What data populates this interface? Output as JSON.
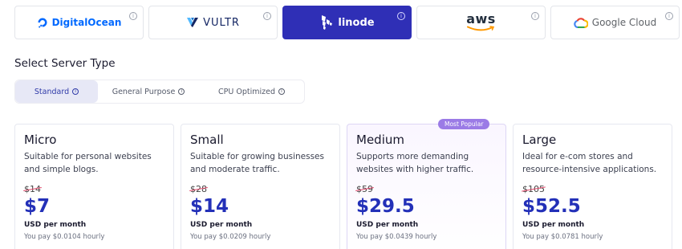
{
  "providers": [
    {
      "name": "DigitalOcean",
      "active": false
    },
    {
      "name": "VULTR",
      "active": false
    },
    {
      "name": "linode",
      "active": true
    },
    {
      "name": "aws",
      "active": false
    },
    {
      "name": "Google Cloud",
      "active": false
    }
  ],
  "section_title": "Select Server Type",
  "tabs": [
    {
      "label": "Standard"
    },
    {
      "label": "General Purpose"
    },
    {
      "label": "CPU Optimized"
    }
  ],
  "cards": [
    {
      "title": "Micro",
      "desc": "Suitable for personal websites and simple blogs.",
      "old_price": "$14",
      "price": "$7",
      "per": "USD per month",
      "hourly": "You pay $0.0104 hourly"
    },
    {
      "title": "Small",
      "desc": "Suitable for growing businesses and moderate traffic.",
      "old_price": "$28",
      "price": "$14",
      "per": "USD per month",
      "hourly": "You pay $0.0209 hourly"
    },
    {
      "title": "Medium",
      "badge": "Most Popular",
      "desc": "Supports more demanding websites with higher traffic.",
      "old_price": "$59",
      "price": "$29.5",
      "per": "USD per month",
      "hourly": "You pay $0.0439 hourly"
    },
    {
      "title": "Large",
      "desc": "Ideal for e-com stores and resource-intensive applications.",
      "old_price": "$105",
      "price": "$52.5",
      "per": "USD per month",
      "hourly": "You pay $0.0781 hourly"
    }
  ],
  "colors": {
    "accent": "#2f2fb6",
    "price": "#2330b8",
    "badge": "#9b7be6"
  }
}
